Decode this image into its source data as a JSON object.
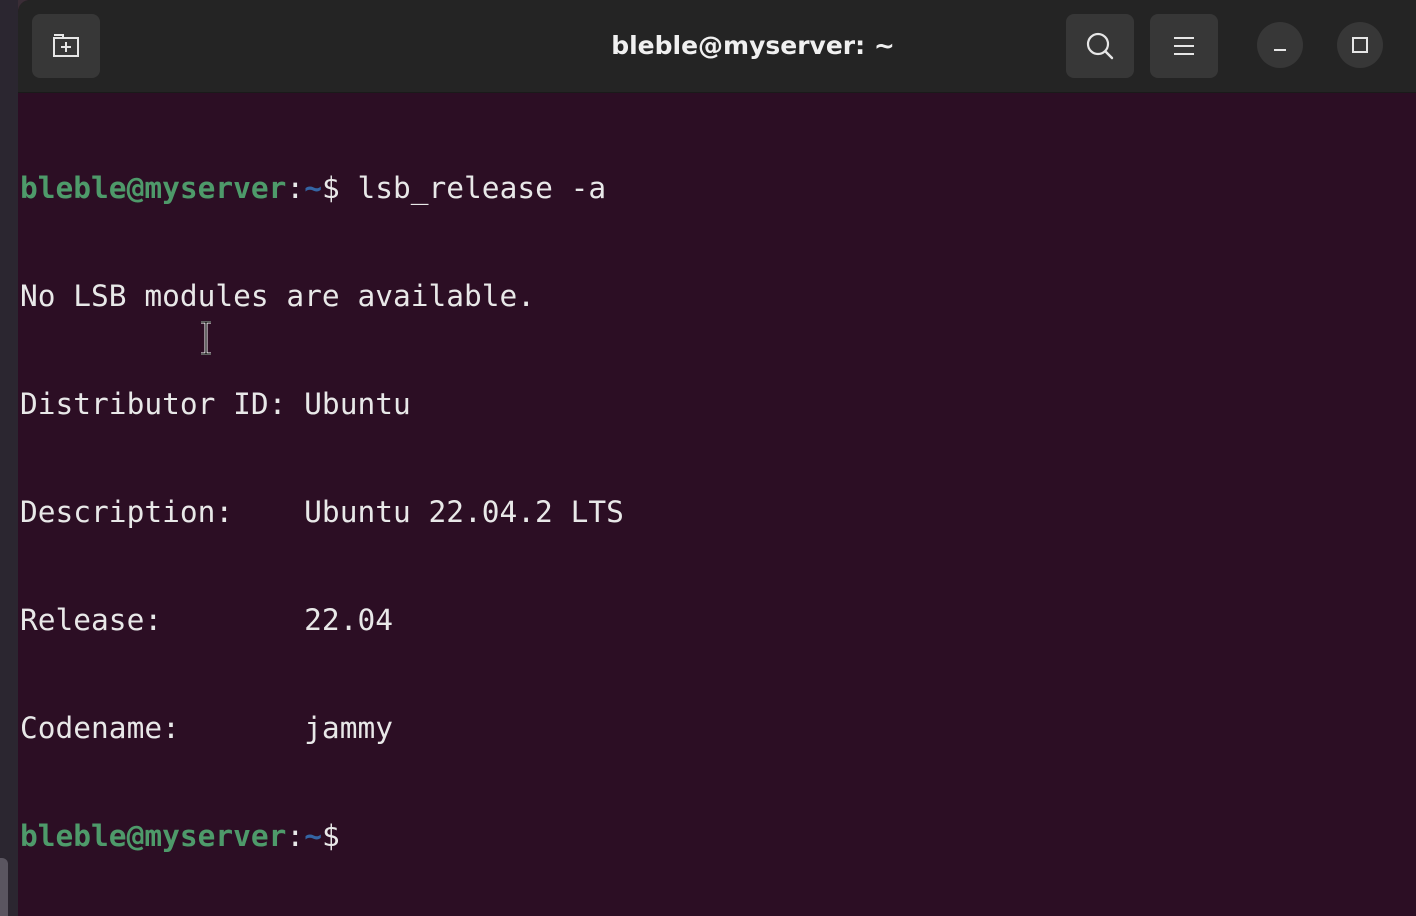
{
  "window": {
    "title": "bleble@myserver: ~"
  },
  "titlebar": {
    "new_tab_icon": "new-tab-icon",
    "search_icon": "search-icon",
    "menu_icon": "hamburger-menu-icon",
    "minimize_icon": "minimize-icon",
    "maximize_icon": "maximize-icon"
  },
  "terminal": {
    "colors": {
      "background": "#2c0e24",
      "user_host": "#4e9a6a",
      "path": "#3465a4",
      "text": "#e8e8e8"
    },
    "lines": [
      {
        "user_host": "bleble@myserver",
        "sep": ":",
        "path": "~",
        "prompt": "$",
        "command": " lsb_release -a"
      },
      {
        "text": "No LSB modules are available."
      },
      {
        "text": "Distributor ID:\tUbuntu"
      },
      {
        "text": "Description:\tUbuntu 22.04.2 LTS"
      },
      {
        "text": "Release:\t22.04"
      },
      {
        "text": "Codename:\tjammy"
      },
      {
        "user_host": "bleble@myserver",
        "sep": ":",
        "path": "~",
        "prompt": "$",
        "command": ""
      }
    ]
  }
}
